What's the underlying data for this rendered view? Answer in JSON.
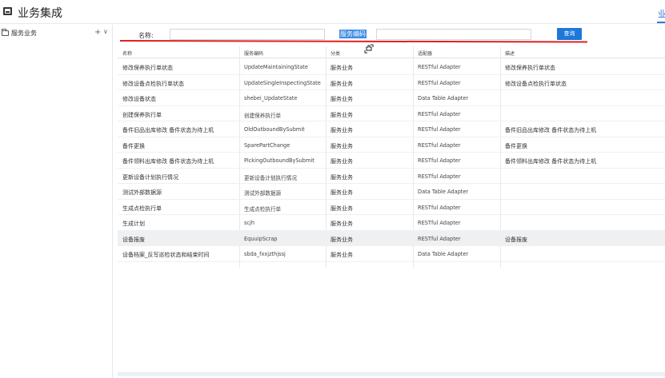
{
  "header": {
    "title": "业务集成",
    "right_tab": "业"
  },
  "sidebar": {
    "items": [
      {
        "label": "服务业务",
        "add": "+",
        "expand": "∨"
      }
    ]
  },
  "search": {
    "name_label": "名称:",
    "name_value": "",
    "code_label": "服务编码",
    "code_value": "",
    "search_button": "查询"
  },
  "table": {
    "columns": [
      "名称",
      "服务编码",
      "分类",
      "适配器",
      "描述"
    ],
    "rows": [
      [
        "修改保养执行单状态",
        "UpdateMaintainingState",
        "服务业务",
        "RESTful Adapter",
        "修改保养执行单状态"
      ],
      [
        "修改设备点检执行单状态",
        "UpdateSingleInspectingState",
        "服务业务",
        "RESTful Adapter",
        "修改设备点检执行单状态"
      ],
      [
        "修改设备状态",
        "shebei_UpdateState",
        "服务业务",
        "Data Table Adapter",
        ""
      ],
      [
        "创建保养执行单",
        "创建保养执行单",
        "服务业务",
        "RESTful Adapter",
        ""
      ],
      [
        "备件旧品出库修改 备件状态为待上机",
        "OldOutboundBySubmit",
        "服务业务",
        "RESTful Adapter",
        "备件旧品出库修改 备件状态为待上机"
      ],
      [
        "备件更换",
        "SparePartChange",
        "服务业务",
        "RESTful Adapter",
        "备件更换"
      ],
      [
        "备件领料出库修改 备件状态为待上机",
        "PickingOutboundBySubmit",
        "服务业务",
        "RESTful Adapter",
        "备件领料出库修改 备件状态为待上机"
      ],
      [
        "更新设备计划执行情况",
        "更新设备计划执行情况",
        "服务业务",
        "RESTful Adapter",
        ""
      ],
      [
        "测试外部数据源",
        "测试外部数据源",
        "服务业务",
        "Data Table Adapter",
        ""
      ],
      [
        "生成点检执行单",
        "生成点检执行单",
        "服务业务",
        "RESTful Adapter",
        ""
      ],
      [
        "生成计划",
        "scjh",
        "服务业务",
        "RESTful Adapter",
        ""
      ],
      [
        "设备报废",
        "EquuipScrap",
        "服务业务",
        "RESTful Adapter",
        "设备报废"
      ],
      [
        "设备档案_反写巡检状态和结束时间",
        "sbda_fxxjzthjssj",
        "服务业务",
        "Data Table Adapter",
        ""
      ]
    ],
    "selected_row": 11
  },
  "colors": {
    "accent": "#1d78d9",
    "highlight": "#3d8be5",
    "annotation": "#e02020",
    "selected_row": "#eef0f2"
  },
  "icons": {
    "app": "monitor-icon",
    "folder": "folder-icon",
    "cursor": "move-cursor-icon"
  }
}
